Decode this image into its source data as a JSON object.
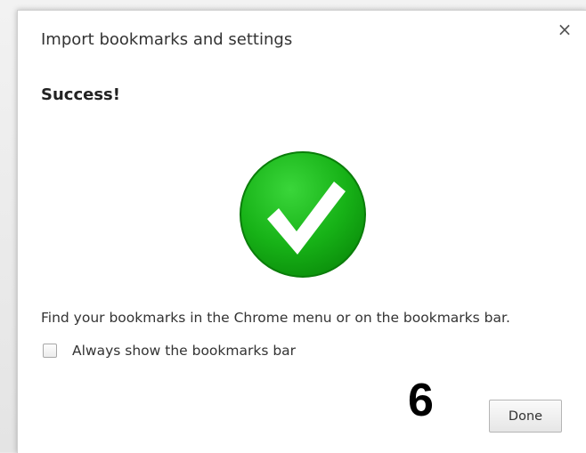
{
  "dialog": {
    "title": "Import bookmarks and settings",
    "close_icon": "close-icon",
    "close_glyph": "×",
    "heading": "Success!",
    "status_icon": "checkmark-success-icon",
    "message": "Find your bookmarks in the Chrome menu or on the bookmarks bar.",
    "checkbox": {
      "label": "Always show the bookmarks bar",
      "checked": false
    },
    "done_label": "Done"
  },
  "annotation": {
    "step_number": "6"
  },
  "colors": {
    "success_green": "#17b217",
    "success_green_dark": "#0b8f0b",
    "check_white": "#ffffff",
    "dialog_bg": "#ffffff",
    "text": "#333333"
  }
}
